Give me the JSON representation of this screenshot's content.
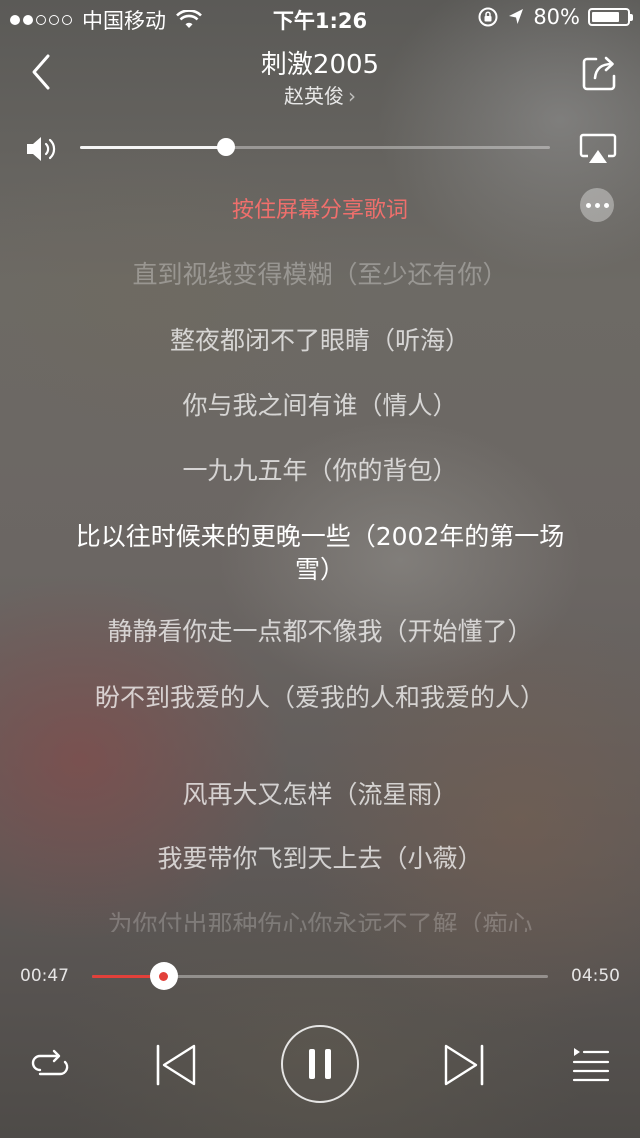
{
  "status_bar": {
    "carrier": "中国移动",
    "time": "下午1:26",
    "battery": "80%",
    "signal_bars": 2,
    "battery_level": 0.8
  },
  "header": {
    "song_title": "刺激2005",
    "artist": "赵英俊",
    "artist_chevron": "›"
  },
  "volume": {
    "level": 0.31
  },
  "share_hint": "按住屏幕分享歌词",
  "lyrics": [
    "直到视线变得模糊（至少还有你）",
    "整夜都闭不了眼睛（听海）",
    "你与我之间有谁（情人）",
    "一九九五年（你的背包）",
    "比以往时候来的更晚一些（2002年的第一场雪）",
    "静静看你走一点都不像我（开始懂了）",
    "盼不到我爱的人（爱我的人和我爱的人）",
    "风再大又怎样（流星雨）",
    "我要带你飞到天上去（小薇）",
    "为你付出那种伤心你永远不了解（痴心"
  ],
  "current_lyric_index": 4,
  "progress": {
    "elapsed": "00:47",
    "total": "04:50",
    "fraction": 0.157
  },
  "icons": {
    "back": "chevron-left-icon",
    "share": "share-icon",
    "volume": "speaker-icon",
    "airplay": "airplay-icon",
    "more": "more-icon",
    "repeat": "repeat-icon",
    "previous": "previous-icon",
    "pause": "pause-icon",
    "next": "next-icon",
    "playlist": "playlist-icon"
  },
  "colors": {
    "accent": "#e2403a",
    "share_hint": "#ef6f6c"
  }
}
